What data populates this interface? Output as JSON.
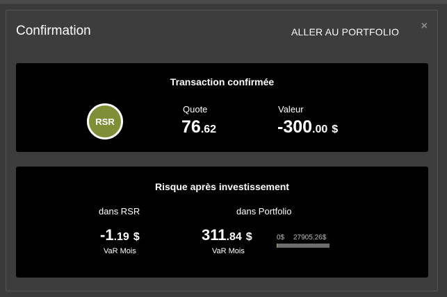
{
  "modal": {
    "title": "Confirmation",
    "goto_link": "ALLER AU PORTFOLIO",
    "close_glyph": "×"
  },
  "transaction": {
    "title": "Transaction confirmée",
    "badge": "RSR",
    "quote_label": "Quote",
    "quote_int": "76",
    "quote_dec": ".62",
    "value_label": "Valeur",
    "value_int": "-300",
    "value_dec": ".00",
    "value_currency": "$"
  },
  "risk": {
    "title": "Risque après investissement",
    "rsr_label": "dans RSR",
    "rsr_int": "-1",
    "rsr_dec": ".19",
    "rsr_currency": "$",
    "rsr_sub": "VaR Mois",
    "portfolio_label": "dans Portfolio",
    "portfolio_int": "311",
    "portfolio_dec": ".84",
    "portfolio_currency": "$",
    "portfolio_sub": "VaR Mois",
    "bar_min_label": "0$",
    "bar_max_label": "27905.26$",
    "bar_fill_fraction": 0.011
  },
  "colors": {
    "badge": "#7f8f37",
    "panel_bg": "#000000",
    "modal_bg": "#3d3d3d",
    "bar_track": "#6d6d6d",
    "bar_fill": "#b0a060"
  }
}
